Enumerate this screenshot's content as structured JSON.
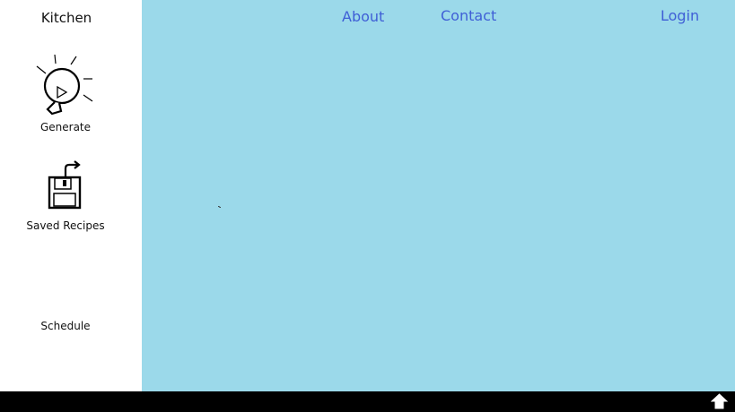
{
  "sidebar": {
    "brand": "Kitchen",
    "items": [
      {
        "label": "Generate",
        "icon": "lightbulb-play-icon"
      },
      {
        "label": "Saved Recipes",
        "icon": "floppy-disk-share-icon"
      },
      {
        "label": "Schedule",
        "icon": ""
      }
    ]
  },
  "nav": {
    "about": "About",
    "contact": "Contact",
    "login": "Login"
  },
  "colors": {
    "main_bg": "#9bd9ea",
    "link": "#3f5fd6",
    "taskbar": "#000000"
  },
  "taskbar": {
    "icon": "home-arrow-icon"
  }
}
